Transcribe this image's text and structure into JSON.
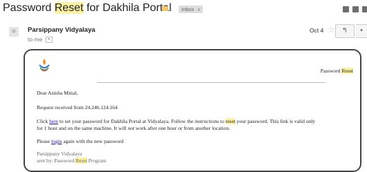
{
  "subject": {
    "before": "Password ",
    "highlight": "Reset",
    "after": " for Dakhila Portal"
  },
  "inbox_chip": {
    "label": "Inbox",
    "close": "x"
  },
  "sender": {
    "name": "Parsippany Vidyalaya",
    "to": "to me",
    "date": "Oct 4"
  },
  "icons": {
    "star": "☆",
    "reply": "↰",
    "more": "▾",
    "dropdown": "▾"
  },
  "colors": {
    "highlight": "#fbf2a3",
    "link": "#1a0dab",
    "label_tag": "#f5c86a",
    "card_border": "#444444"
  },
  "email": {
    "header_title": {
      "before": "Password ",
      "highlight": "Reset"
    },
    "greeting": "Dear Anisha Mittal,",
    "request_line": "Request received from 24.246.124.164",
    "instructions": {
      "p1": "Click ",
      "link": "here",
      "p2": " to set your password for Dakhila Portal at Vidyalaya. Follow the instructions to ",
      "hl": "reset",
      "p3": " your password. This link is valid only",
      "line2a": "for 1 hour and on the same machine. It will ",
      "em": "not",
      "line2b": " work after one hour or from another location."
    },
    "login_line": {
      "before": "Please ",
      "link": "login",
      "after": " again with the new password"
    },
    "signature": {
      "org": "Parsippany Vidyalaya",
      "sent_by_before": "sent by: Password ",
      "sent_by_hl": "Reset",
      "sent_by_after": " Program"
    }
  }
}
